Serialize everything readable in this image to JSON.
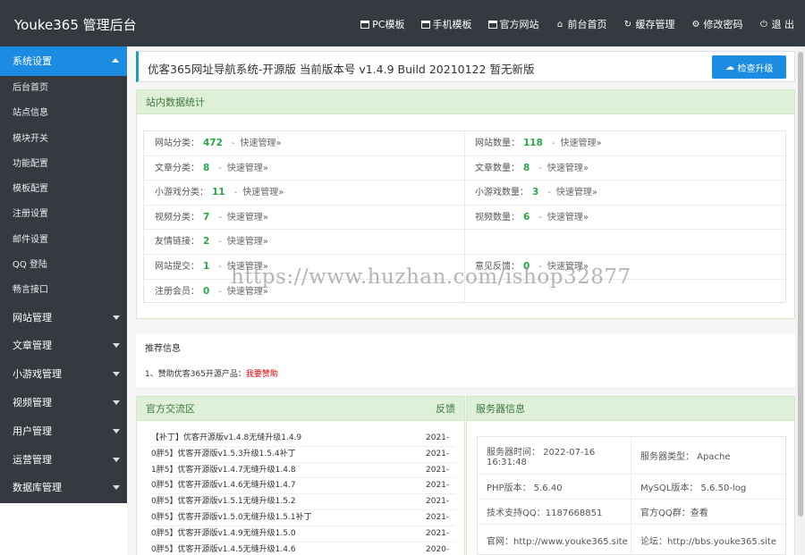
{
  "topbar": {
    "brand": "Youke365 管理后台",
    "nav": [
      {
        "label": "PC模板",
        "icon": "window-icon"
      },
      {
        "label": "手机模板",
        "icon": "window-icon"
      },
      {
        "label": "官方网站",
        "icon": "window-icon"
      },
      {
        "label": "前台首页",
        "icon": "home-icon"
      },
      {
        "label": "缓存管理",
        "icon": "refresh-icon"
      },
      {
        "label": "修改密码",
        "icon": "gear-icon"
      },
      {
        "label": "退 出",
        "icon": "power-icon"
      }
    ]
  },
  "sidebar": {
    "active_group": "系统设置",
    "sub_items": [
      "后台首页",
      "站点信息",
      "模块开关",
      "功能配置",
      "模板配置",
      "注册设置",
      "邮件设置",
      "QQ 登陆",
      "畅言接口"
    ],
    "groups": [
      "网站管理",
      "文章管理",
      "小游戏管理",
      "视频管理",
      "用户管理",
      "运营管理",
      "数据库管理"
    ]
  },
  "header": {
    "title": "优客365网址导航系统-开源版 当前版本号 v1.4.9 Build 20210122 暂无新版",
    "upgrade_button": "检查升级"
  },
  "stats": {
    "title": "站内数据统计",
    "quick_label": "快速管理»",
    "rows": [
      [
        {
          "label": "网站分类：",
          "value": "472"
        },
        {
          "label": "网站数量：",
          "value": "118"
        }
      ],
      [
        {
          "label": "文章分类：",
          "value": "8"
        },
        {
          "label": "文章数量：",
          "value": "8"
        }
      ],
      [
        {
          "label": "小游戏分类：",
          "value": "11"
        },
        {
          "label": "小游戏数量：",
          "value": "3"
        }
      ],
      [
        {
          "label": "视频分类：",
          "value": "7"
        },
        {
          "label": "视频数量：",
          "value": "6"
        }
      ],
      [
        {
          "label": "友情链接：",
          "value": "2"
        },
        null
      ],
      [
        {
          "label": "网站提交：",
          "value": "1"
        },
        {
          "label": "意见反馈：",
          "value": "0"
        }
      ],
      [
        {
          "label": "注册会员：",
          "value": "0"
        },
        null
      ]
    ]
  },
  "recommend": {
    "title": "推荐信息",
    "line_prefix": "1、赞助优客365开源产品：",
    "line_link": "我要赞助"
  },
  "exchange": {
    "title": "官方交流区",
    "feedback": "反馈",
    "items": [
      {
        "text": "【补丁】优客开源版v1.4.8无缝升级1.4.9",
        "date": "2021-"
      },
      {
        "text": "0胖5】优客开源版v1.5.3升级1.5.4补丁",
        "date": "2021-"
      },
      {
        "text": "1胖5】优客开源版v1.4.7无缝升级1.4.8",
        "date": "2021-"
      },
      {
        "text": "0胖5】优客开源版v1.4.6无缝升级1.4.7",
        "date": "2021-"
      },
      {
        "text": "0胖5】优客开源版v1.5.1无缝升级1.5.2",
        "date": "2021-"
      },
      {
        "text": "0胖5】优客开源版v1.5.0无缝升级1.5.1补丁",
        "date": "2021-"
      },
      {
        "text": "0胖5】优客开源版v1.4.9无缝升级1.5.0",
        "date": "2021-"
      },
      {
        "text": "0胖5】优客开源版v1.4.5无缝升级1.4.6",
        "date": "2020-"
      }
    ]
  },
  "server": {
    "title": "服务器信息",
    "rows": [
      {
        "l": "服务器时间： 2022-07-16 16:31:48",
        "r": "服务器类型： Apache"
      },
      {
        "l": "PHP版本： 5.6.40",
        "r": "MySQL版本： 5.6.50-log"
      },
      {
        "l": "技术支持QQ：1187668851",
        "r": "官方QQ群：查看"
      },
      {
        "l": "官网：http://www.youke365.site",
        "r": "论坛：http://bbs.youke365.site"
      }
    ]
  },
  "watermark": "https://www.huzhan.com/ishop32877"
}
